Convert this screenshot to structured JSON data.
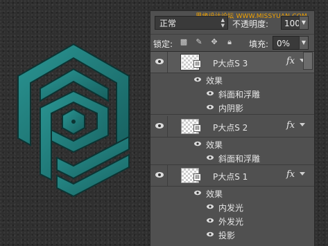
{
  "watermark": "思缘设计论坛 WWW.MISSYUAN.COM",
  "panel": {
    "blend_mode": "正常",
    "opacity_label": "不透明度:",
    "opacity_value": "100%",
    "lock_label": "锁定:",
    "fill_label": "填充:",
    "fill_value": "0%",
    "icons": [
      "lock-transparent-pixels-icon",
      "lock-image-pixels-icon",
      "lock-position-icon",
      "lock-all-icon"
    ]
  },
  "layers": [
    {
      "name": "P大点S 3",
      "selected": true,
      "fx": "fx",
      "effects_label": "效果",
      "effects": [
        "斜面和浮雕",
        "内阴影"
      ]
    },
    {
      "name": "P大点S 2",
      "selected": false,
      "fx": "fx",
      "effects_label": "效果",
      "effects": [
        "斜面和浮雕"
      ]
    },
    {
      "name": "P大点S 1",
      "selected": false,
      "fx": "fx",
      "effects_label": "效果",
      "effects": [
        "内发光",
        "外发光",
        "投影"
      ]
    }
  ],
  "colors": {
    "logo_teal": "#1f7e7c",
    "panel_bg": "#505050",
    "selected_row": "#5a5a5a"
  }
}
